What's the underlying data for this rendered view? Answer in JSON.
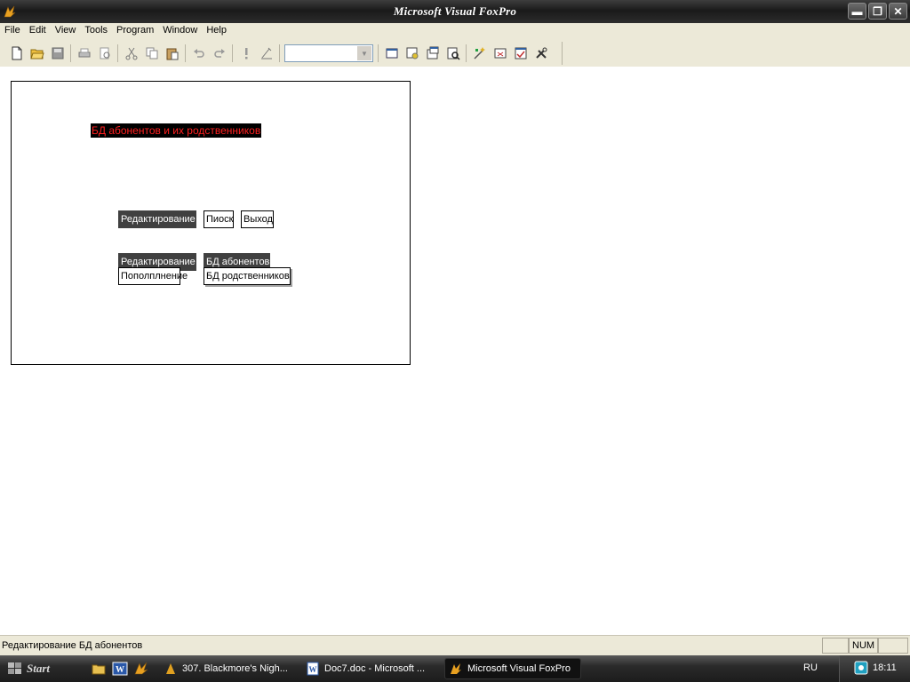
{
  "window": {
    "title": "Microsoft Visual FoxPro"
  },
  "window_buttons": {
    "minimize": "▬",
    "maximize": "❐",
    "close": "✕"
  },
  "menu": [
    "File",
    "Edit",
    "View",
    "Tools",
    "Program",
    "Window",
    "Help"
  ],
  "toolbar": {
    "combo_value": ""
  },
  "form": {
    "title_label": "БД абонентов и их родственников",
    "buttons": {
      "edit1": "Редактирование",
      "search": "Пиоск",
      "exit": "Выход",
      "edit2": "Редактирование",
      "subscribers_db": "БД абонентов",
      "replenish": "Пополплнение",
      "relatives_db": "БД родственников"
    }
  },
  "statusbar": {
    "text": "Редактирование БД абонентов",
    "num": "NUM"
  },
  "taskbar": {
    "start": "Start",
    "tasks": [
      "307. Blackmore's Nigh...",
      "Doc7.doc - Microsoft ...",
      "Microsoft Visual FoxPro"
    ],
    "lang": "RU",
    "clock": "18:11"
  },
  "colors": {
    "form_title_text": "#ff2020",
    "form_title_bg": "#000000",
    "dark_button": "#404040"
  }
}
